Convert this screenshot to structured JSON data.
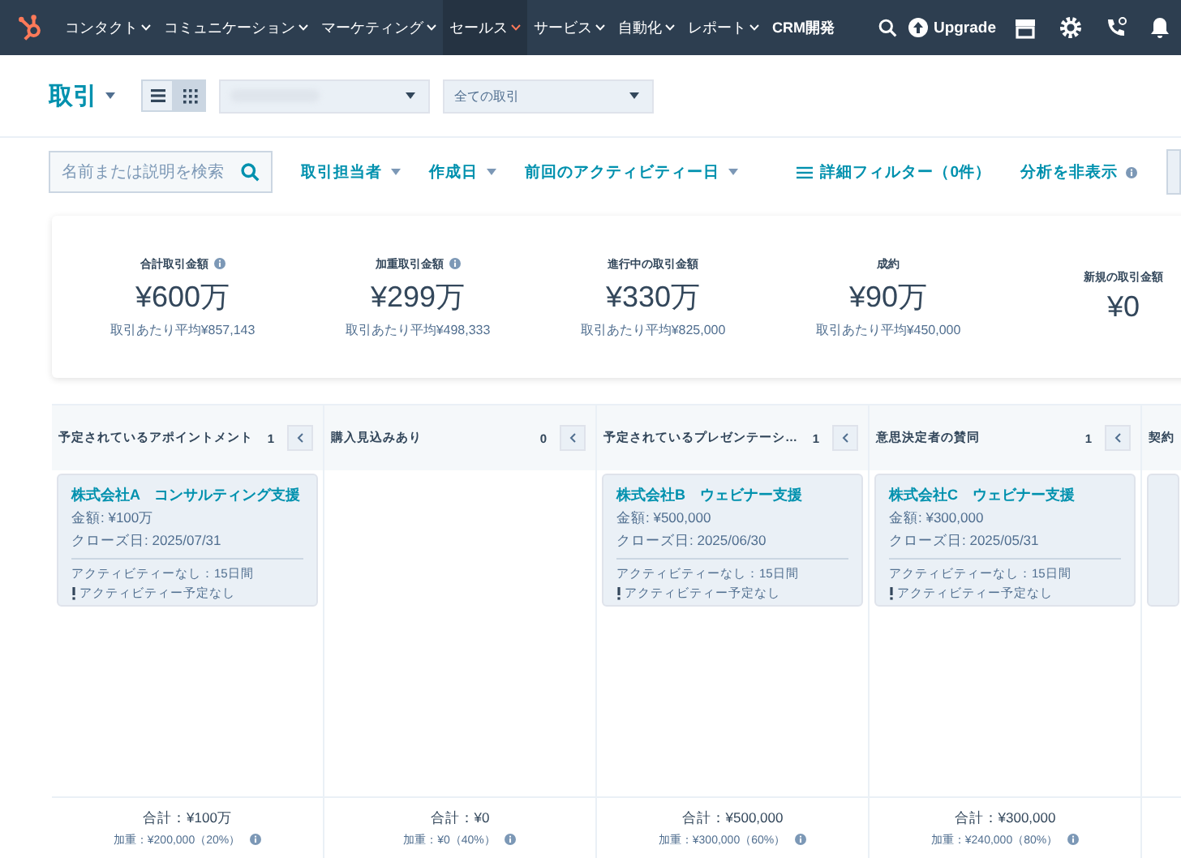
{
  "nav": {
    "items": [
      {
        "label": "コンタクト",
        "dropdown": true,
        "selected": false
      },
      {
        "label": "コミュニケーション",
        "dropdown": true,
        "selected": false
      },
      {
        "label": "マーケティング",
        "dropdown": true,
        "selected": false
      },
      {
        "label": "セールス",
        "dropdown": true,
        "selected": true
      },
      {
        "label": "サービス",
        "dropdown": true,
        "selected": false
      },
      {
        "label": "自動化",
        "dropdown": true,
        "selected": false
      },
      {
        "label": "レポート",
        "dropdown": true,
        "selected": false
      },
      {
        "label": "CRM開発",
        "dropdown": false,
        "selected": false
      }
    ],
    "upgrade": "Upgrade"
  },
  "header": {
    "title": "取引",
    "views": [
      {
        "kind": "list",
        "selected": false
      },
      {
        "kind": "board",
        "selected": true
      }
    ],
    "pipeline_filter": "全ての取引"
  },
  "filters": {
    "search": {
      "placeholder": "名前または説明を検索"
    },
    "dropdowns": [
      "取引担当者",
      "作成日",
      "前回のアクティビティー日"
    ],
    "advanced": "詳細フィルター（0件）",
    "hide_analytics": "分析を非表示"
  },
  "stats": [
    {
      "label": "合計取引金額",
      "info": true,
      "value": "¥600万",
      "average": "取引あたり平均¥857,143"
    },
    {
      "label": "加重取引金額",
      "info": true,
      "value": "¥299万",
      "average": "取引あたり平均¥498,333"
    },
    {
      "label": "進行中の取引金額",
      "info": false,
      "value": "¥330万",
      "average": "取引あたり平均¥825,000"
    },
    {
      "label": "成約",
      "info": false,
      "value": "¥90万",
      "average": "取引あたり平均¥450,000"
    },
    {
      "label": "新規の取引金額",
      "info": false,
      "value": "¥0"
    }
  ],
  "columns": [
    {
      "title": "予定されているアポイントメント",
      "count": "1",
      "cards": [
        {
          "name": "株式会社A　コンサルティング支援",
          "amount": "金額: ¥100万",
          "close_date": "クローズ日: 2025/07/31",
          "activity": "アクティビティーなし：15日間",
          "warning": "アクティビティー予定なし"
        }
      ],
      "total": "合計：¥100万",
      "weighted": "加重：¥200,000（20%）"
    },
    {
      "title": "購入見込みあり",
      "count": "0",
      "total": "合計：¥0",
      "weighted": "加重：¥0（40%）"
    },
    {
      "title": "予定されているプレゼンテーシ…",
      "count": "1",
      "cards": [
        {
          "name": "株式会社B　ウェビナー支援",
          "amount": "金額: ¥500,000",
          "close_date": "クローズ日: 2025/06/30",
          "activity": "アクティビティーなし：15日間",
          "warning": "アクティビティー予定なし"
        }
      ],
      "total": "合計：¥500,000",
      "weighted": "加重：¥300,000（60%）"
    },
    {
      "title": "意思決定者の賛同",
      "count": "1",
      "cards": [
        {
          "name": "株式会社C　ウェビナー支援",
          "amount": "金額: ¥300,000",
          "close_date": "クローズ日: 2025/05/31",
          "activity": "アクティビティーなし：15日間",
          "warning": "アクティビティー予定なし"
        }
      ],
      "total": "合計：¥300,000",
      "weighted": "加重：¥240,000（80%）"
    },
    {
      "title": "契約"
    }
  ]
}
